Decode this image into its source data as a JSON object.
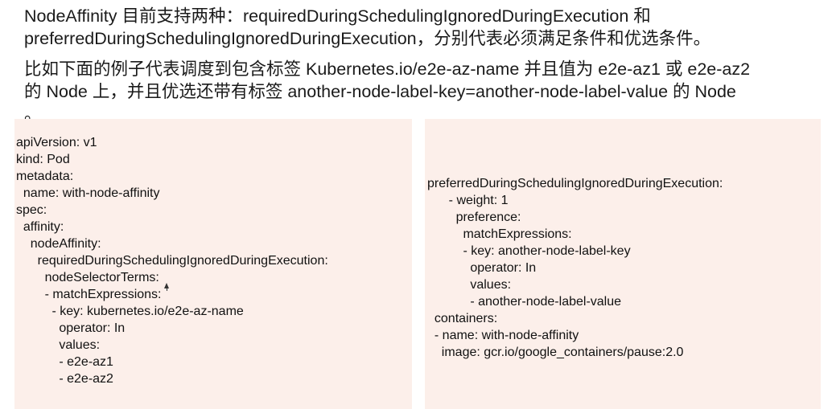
{
  "paragraphs": [
    {
      "lines": [
        "NodeAffinity 目前支持两种：requiredDuringSchedulingIgnoredDuringExecution 和",
        "preferredDuringSchedulingIgnoredDuringExecution，分别代表必须满足条件和优选条件。"
      ]
    },
    {
      "lines": [
        "比如下面的例子代表调度到包含标签 Kubernetes.io/e2e-az-name 并且值为 e2e-az1 或 e2e-az2",
        "的 Node 上，并且优选还带有标签 another-node-label-key=another-node-label-value 的 Node",
        "。"
      ]
    }
  ],
  "code_left": [
    "apiVersion: v1",
    "kind: Pod",
    "metadata:",
    "  name: with-node-affinity",
    "spec:",
    "  affinity:",
    "    nodeAffinity:",
    "      requiredDuringSchedulingIgnoredDuringExecution:",
    "        nodeSelectorTerms:",
    "        - matchExpressions:",
    "          - key: kubernetes.io/e2e-az-name",
    "            operator: In",
    "            values:",
    "            - e2e-az1",
    "            - e2e-az2"
  ],
  "code_right": [
    "preferredDuringSchedulingIgnoredDuringExecution:",
    "      - weight: 1",
    "        preference:",
    "          matchExpressions:",
    "          - key: another-node-label-key",
    "            operator: In",
    "            values:",
    "            - another-node-label-value",
    "  containers:",
    "  - name: with-node-affinity",
    "    image: gcr.io/google_containers/pause:2.0"
  ],
  "colors": {
    "code_background": "#fcefea",
    "text": "#1a1a1a"
  },
  "icons": {
    "cursor": "mouse-cursor-icon"
  }
}
